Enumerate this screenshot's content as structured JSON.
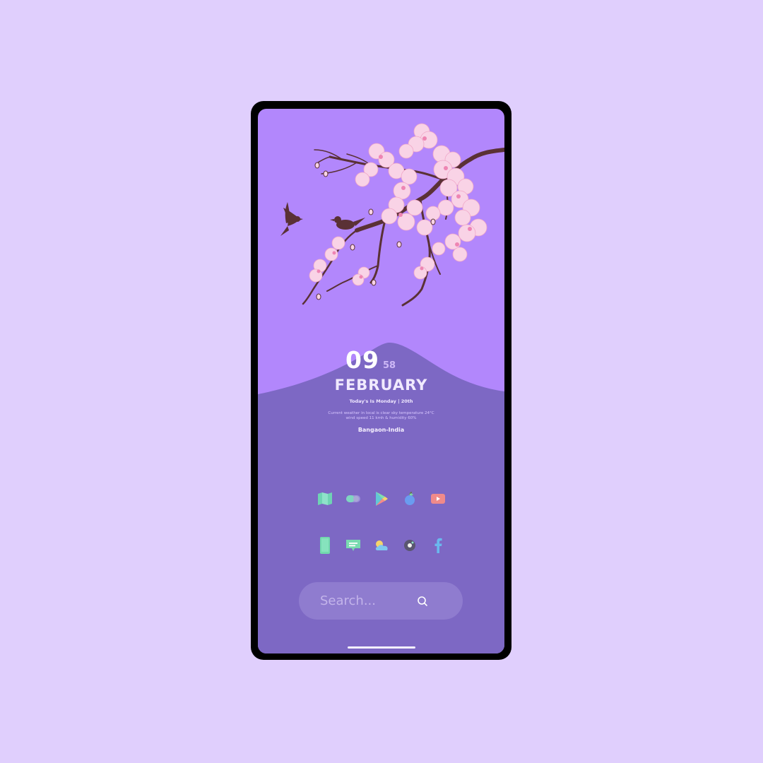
{
  "wallpaper": {
    "sky_color": "#b287fc",
    "hill_color": "#7d68c4",
    "branch_color": "#5a3135",
    "blossom_color": "#f9d3e6",
    "bird_count": 2
  },
  "clock": {
    "hour": "09",
    "minute": "58"
  },
  "date": {
    "month": "FEBRUARY",
    "today_line": "Today's Is Monday | 20th"
  },
  "weather": {
    "line1": "Current weather in local is clear sky temperature 24°C",
    "line2": "wind speed 11 kmh & humidity 60%"
  },
  "location": "Bangaon-India",
  "apps": {
    "row1": [
      {
        "icon": "maps-icon"
      },
      {
        "icon": "toggle-icon"
      },
      {
        "icon": "play-store-icon"
      },
      {
        "icon": "apple-icon"
      },
      {
        "icon": "youtube-icon"
      }
    ],
    "row2": [
      {
        "icon": "phone-icon"
      },
      {
        "icon": "messages-icon"
      },
      {
        "icon": "weather-icon"
      },
      {
        "icon": "camera-icon"
      },
      {
        "icon": "facebook-icon"
      }
    ]
  },
  "search": {
    "placeholder": "Search...",
    "icon": "search-icon"
  }
}
